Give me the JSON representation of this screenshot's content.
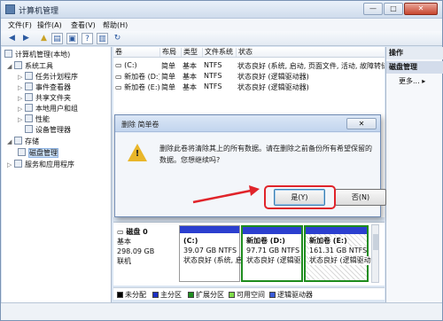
{
  "window": {
    "title": "计算机管理",
    "min": "—",
    "max": "□",
    "close": "✕"
  },
  "menu": [
    {
      "label": "文件(F)"
    },
    {
      "label": "操作(A)"
    },
    {
      "label": "查看(V)"
    },
    {
      "label": "帮助(H)"
    }
  ],
  "tree": {
    "root": "计算机管理(本地)",
    "system_tools": "系统工具",
    "task_scheduler": "任务计划程序",
    "event_viewer": "事件查看器",
    "shared_folders": "共享文件夹",
    "local_users": "本地用户和组",
    "performance": "性能",
    "device_manager": "设备管理器",
    "storage": "存储",
    "disk_management": "磁盘管理",
    "services_apps": "服务和应用程序"
  },
  "volumes": {
    "columns": [
      "卷",
      "布局",
      "类型",
      "文件系统",
      "状态"
    ],
    "rows": [
      [
        "(C:)",
        "简单",
        "基本",
        "NTFS",
        "状态良好 (系统, 启动, 页面文件, 活动, 故障转储, 主分区)"
      ],
      [
        "新加卷 (D:)",
        "简单",
        "基本",
        "NTFS",
        "状态良好 (逻辑驱动器)"
      ],
      [
        "新加卷 (E:)",
        "简单",
        "基本",
        "NTFS",
        "状态良好 (逻辑驱动器)"
      ]
    ]
  },
  "actions": {
    "title": "操作",
    "section": "磁盘管理",
    "more": "更多..."
  },
  "disk": {
    "name": "磁盘 0",
    "type": "基本",
    "size": "298.09 GB",
    "status": "联机",
    "partitions": [
      {
        "name": "(C:)",
        "size": "39.07 GB NTFS",
        "status": "状态良好 (系统, 启"
      },
      {
        "name": "新加卷 (D:)",
        "size": "97.71 GB NTFS",
        "status": "状态良好 (逻辑驱"
      },
      {
        "name": "新加卷 (E:)",
        "size": "161.31 GB NTFS",
        "status": "状态良好 (逻辑驱动"
      }
    ]
  },
  "legend": [
    {
      "label": "未分配",
      "color": "#000000"
    },
    {
      "label": "主分区",
      "color": "#1a2fc4"
    },
    {
      "label": "扩展分区",
      "color": "#1f8f1f"
    },
    {
      "label": "可用空间",
      "color": "#7fdc4a"
    },
    {
      "label": "逻辑驱动器",
      "color": "#3a5bd8"
    }
  ],
  "dialog": {
    "title": "删除 简单卷",
    "close": "✕",
    "message": "删除此卷将清除其上的所有数据。请在删除之前备份所有希望保留的数据。您想继续吗?",
    "yes": "是(Y)",
    "no": "否(N)"
  },
  "colors": {
    "highlight": "#e0242a",
    "primary_partition_bar": "#2b3fcf",
    "selected_partition_border": "#1e8c1e"
  }
}
